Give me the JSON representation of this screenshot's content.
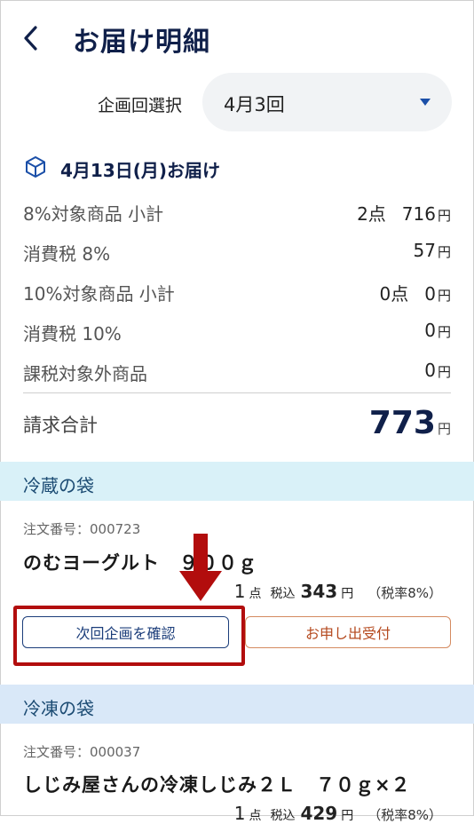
{
  "header": {
    "title": "お届け明細"
  },
  "plan": {
    "label": "企画回選択",
    "value": "4月3回"
  },
  "delivery": {
    "date": "4月13日(月)お届け"
  },
  "summary": {
    "rows": [
      {
        "label": "8%対象商品 小計",
        "count": "2点",
        "amount": "716",
        "unit": "円"
      },
      {
        "label": "消費税 8%",
        "count": "",
        "amount": "57",
        "unit": "円"
      },
      {
        "label": "10%対象商品 小計",
        "count": "0点",
        "amount": "0",
        "unit": "円"
      },
      {
        "label": "消費税 10%",
        "count": "",
        "amount": "0",
        "unit": "円"
      },
      {
        "label": "課税対象外商品",
        "count": "",
        "amount": "0",
        "unit": "円"
      }
    ],
    "total_label": "請求合計",
    "total_amount": "773",
    "total_unit": "円"
  },
  "bags": [
    {
      "name": "冷蔵の袋",
      "order_no": "注文番号：000723",
      "product": "のむヨーグルト　９００ｇ",
      "qty": "1",
      "qty_unit": "点",
      "tax_label": "税込",
      "price": "343",
      "price_unit": "円",
      "rate": "（税率8%）"
    },
    {
      "name": "冷凍の袋",
      "order_no": "注文番号：000037",
      "product": "しじみ屋さんの冷凍しじみ２Ｌ　７０ｇ×２",
      "qty": "1",
      "qty_unit": "点",
      "tax_label": "税込",
      "price": "429",
      "price_unit": "円",
      "rate": "（税率8%）"
    }
  ],
  "buttons": {
    "next_plan": "次回企画を確認",
    "apply": "お申し出受付"
  },
  "colors": {
    "accent": "#1b3d7a",
    "annotation": "#b20d0d",
    "apply_text": "#b54a1f"
  },
  "icons": {
    "back": "chevron-left-icon",
    "caret": "caret-down-icon",
    "box": "package-icon"
  }
}
